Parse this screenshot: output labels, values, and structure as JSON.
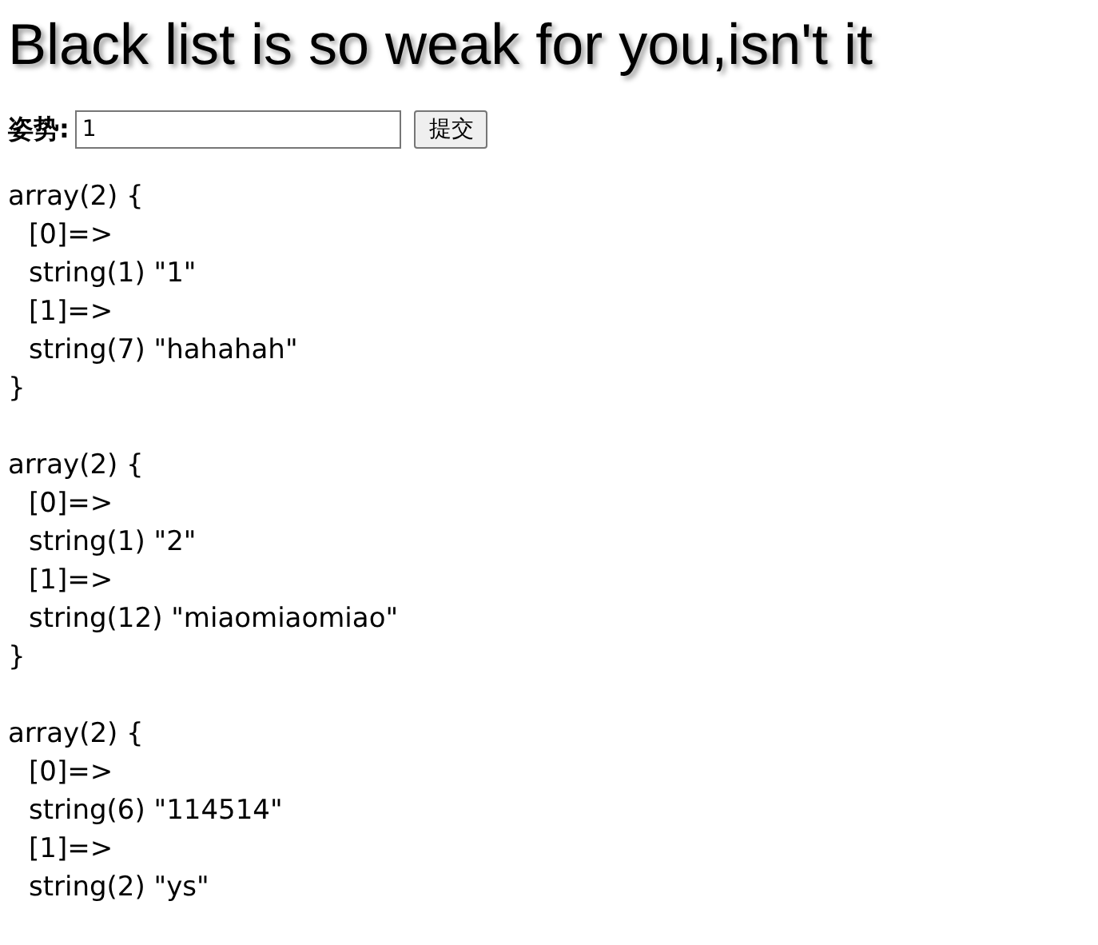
{
  "title": "Black list is so weak for you,isn't it",
  "form": {
    "label": "姿势:",
    "value": "1",
    "button": "提交"
  },
  "dumps": [
    {
      "open": "array(2) {",
      "lines": [
        "[0]=>",
        "string(1) \"1\"",
        "[1]=>",
        "string(7) \"hahahah\""
      ],
      "close": "}"
    },
    {
      "open": "array(2) {",
      "lines": [
        "[0]=>",
        "string(1) \"2\"",
        "[1]=>",
        "string(12) \"miaomiaomiao\""
      ],
      "close": "}"
    },
    {
      "open": "array(2) {",
      "lines": [
        "[0]=>",
        "string(6) \"114514\"",
        "[1]=>",
        "string(2) \"ys\""
      ]
    }
  ]
}
